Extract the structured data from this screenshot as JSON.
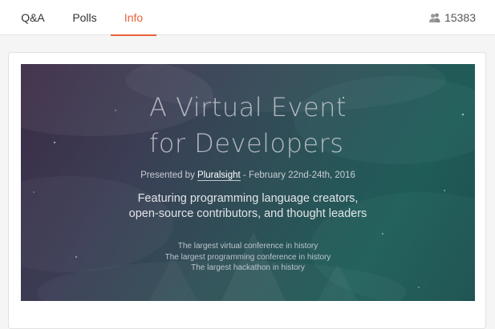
{
  "tabs": [
    {
      "label": "Q&A",
      "active": false
    },
    {
      "label": "Polls",
      "active": false
    },
    {
      "label": "Info",
      "active": true
    }
  ],
  "viewer_count": {
    "icon": "users-icon",
    "value": "15383"
  },
  "banner": {
    "headline_line1": "A Virtual Event",
    "headline_line2": "for Developers",
    "presented_prefix": "Presented by ",
    "presented_brand": "Pluralsight",
    "presented_suffix": " - February 22nd-24th, 2016",
    "featuring_line1": "Featuring programming language creators,",
    "featuring_line2": "open-source contributors, and thought leaders",
    "bullets": [
      "The largest virtual conference in history",
      "The largest programming conference in history",
      "The largest hackathon in history"
    ]
  },
  "colors": {
    "accent": "#e8623a",
    "tab_text": "#333333",
    "banner_start": "#3b2b45",
    "banner_end": "#1e4f4f"
  }
}
